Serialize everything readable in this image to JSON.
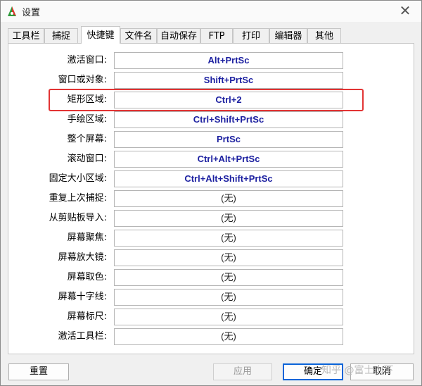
{
  "window": {
    "title": "设置",
    "close_glyph": "✕"
  },
  "tabs": [
    {
      "label": "工具栏",
      "active": false
    },
    {
      "label": "捕捉",
      "active": false
    },
    {
      "label": "快捷键",
      "active": true
    },
    {
      "label": "文件名",
      "active": false
    },
    {
      "label": "自动保存",
      "active": false
    },
    {
      "label": "FTP",
      "active": false
    },
    {
      "label": "打印",
      "active": false
    },
    {
      "label": "编辑器",
      "active": false
    },
    {
      "label": "其他",
      "active": false
    }
  ],
  "shortcuts": [
    {
      "label": "激活窗口:",
      "value": "Alt+PrtSc"
    },
    {
      "label": "窗口或对象:",
      "value": "Shift+PrtSc"
    },
    {
      "label": "矩形区域:",
      "value": "Ctrl+2"
    },
    {
      "label": "手绘区域:",
      "value": "Ctrl+Shift+PrtSc"
    },
    {
      "label": "整个屏幕:",
      "value": "PrtSc"
    },
    {
      "label": "滚动窗口:",
      "value": "Ctrl+Alt+PrtSc"
    },
    {
      "label": "固定大小区域:",
      "value": "Ctrl+Alt+Shift+PrtSc"
    },
    {
      "label": "重复上次捕捉:",
      "value": "(无)"
    },
    {
      "label": "从剪贴板导入:",
      "value": "(无)"
    },
    {
      "label": "屏幕聚焦:",
      "value": "(无)"
    },
    {
      "label": "屏幕放大镜:",
      "value": "(无)"
    },
    {
      "label": "屏幕取色:",
      "value": "(无)"
    },
    {
      "label": "屏幕十字线:",
      "value": "(无)"
    },
    {
      "label": "屏幕标尺:",
      "value": "(无)"
    },
    {
      "label": "激活工具栏:",
      "value": "(无)"
    }
  ],
  "buttons": {
    "reset": "重置",
    "apply": "应用",
    "ok": "确定",
    "cancel": "取消"
  },
  "watermark": "知乎 @富士山下",
  "colors": {
    "assigned_key": "#1b1fa0",
    "highlight": "#e23434",
    "default_button_border": "#0a64d8"
  }
}
